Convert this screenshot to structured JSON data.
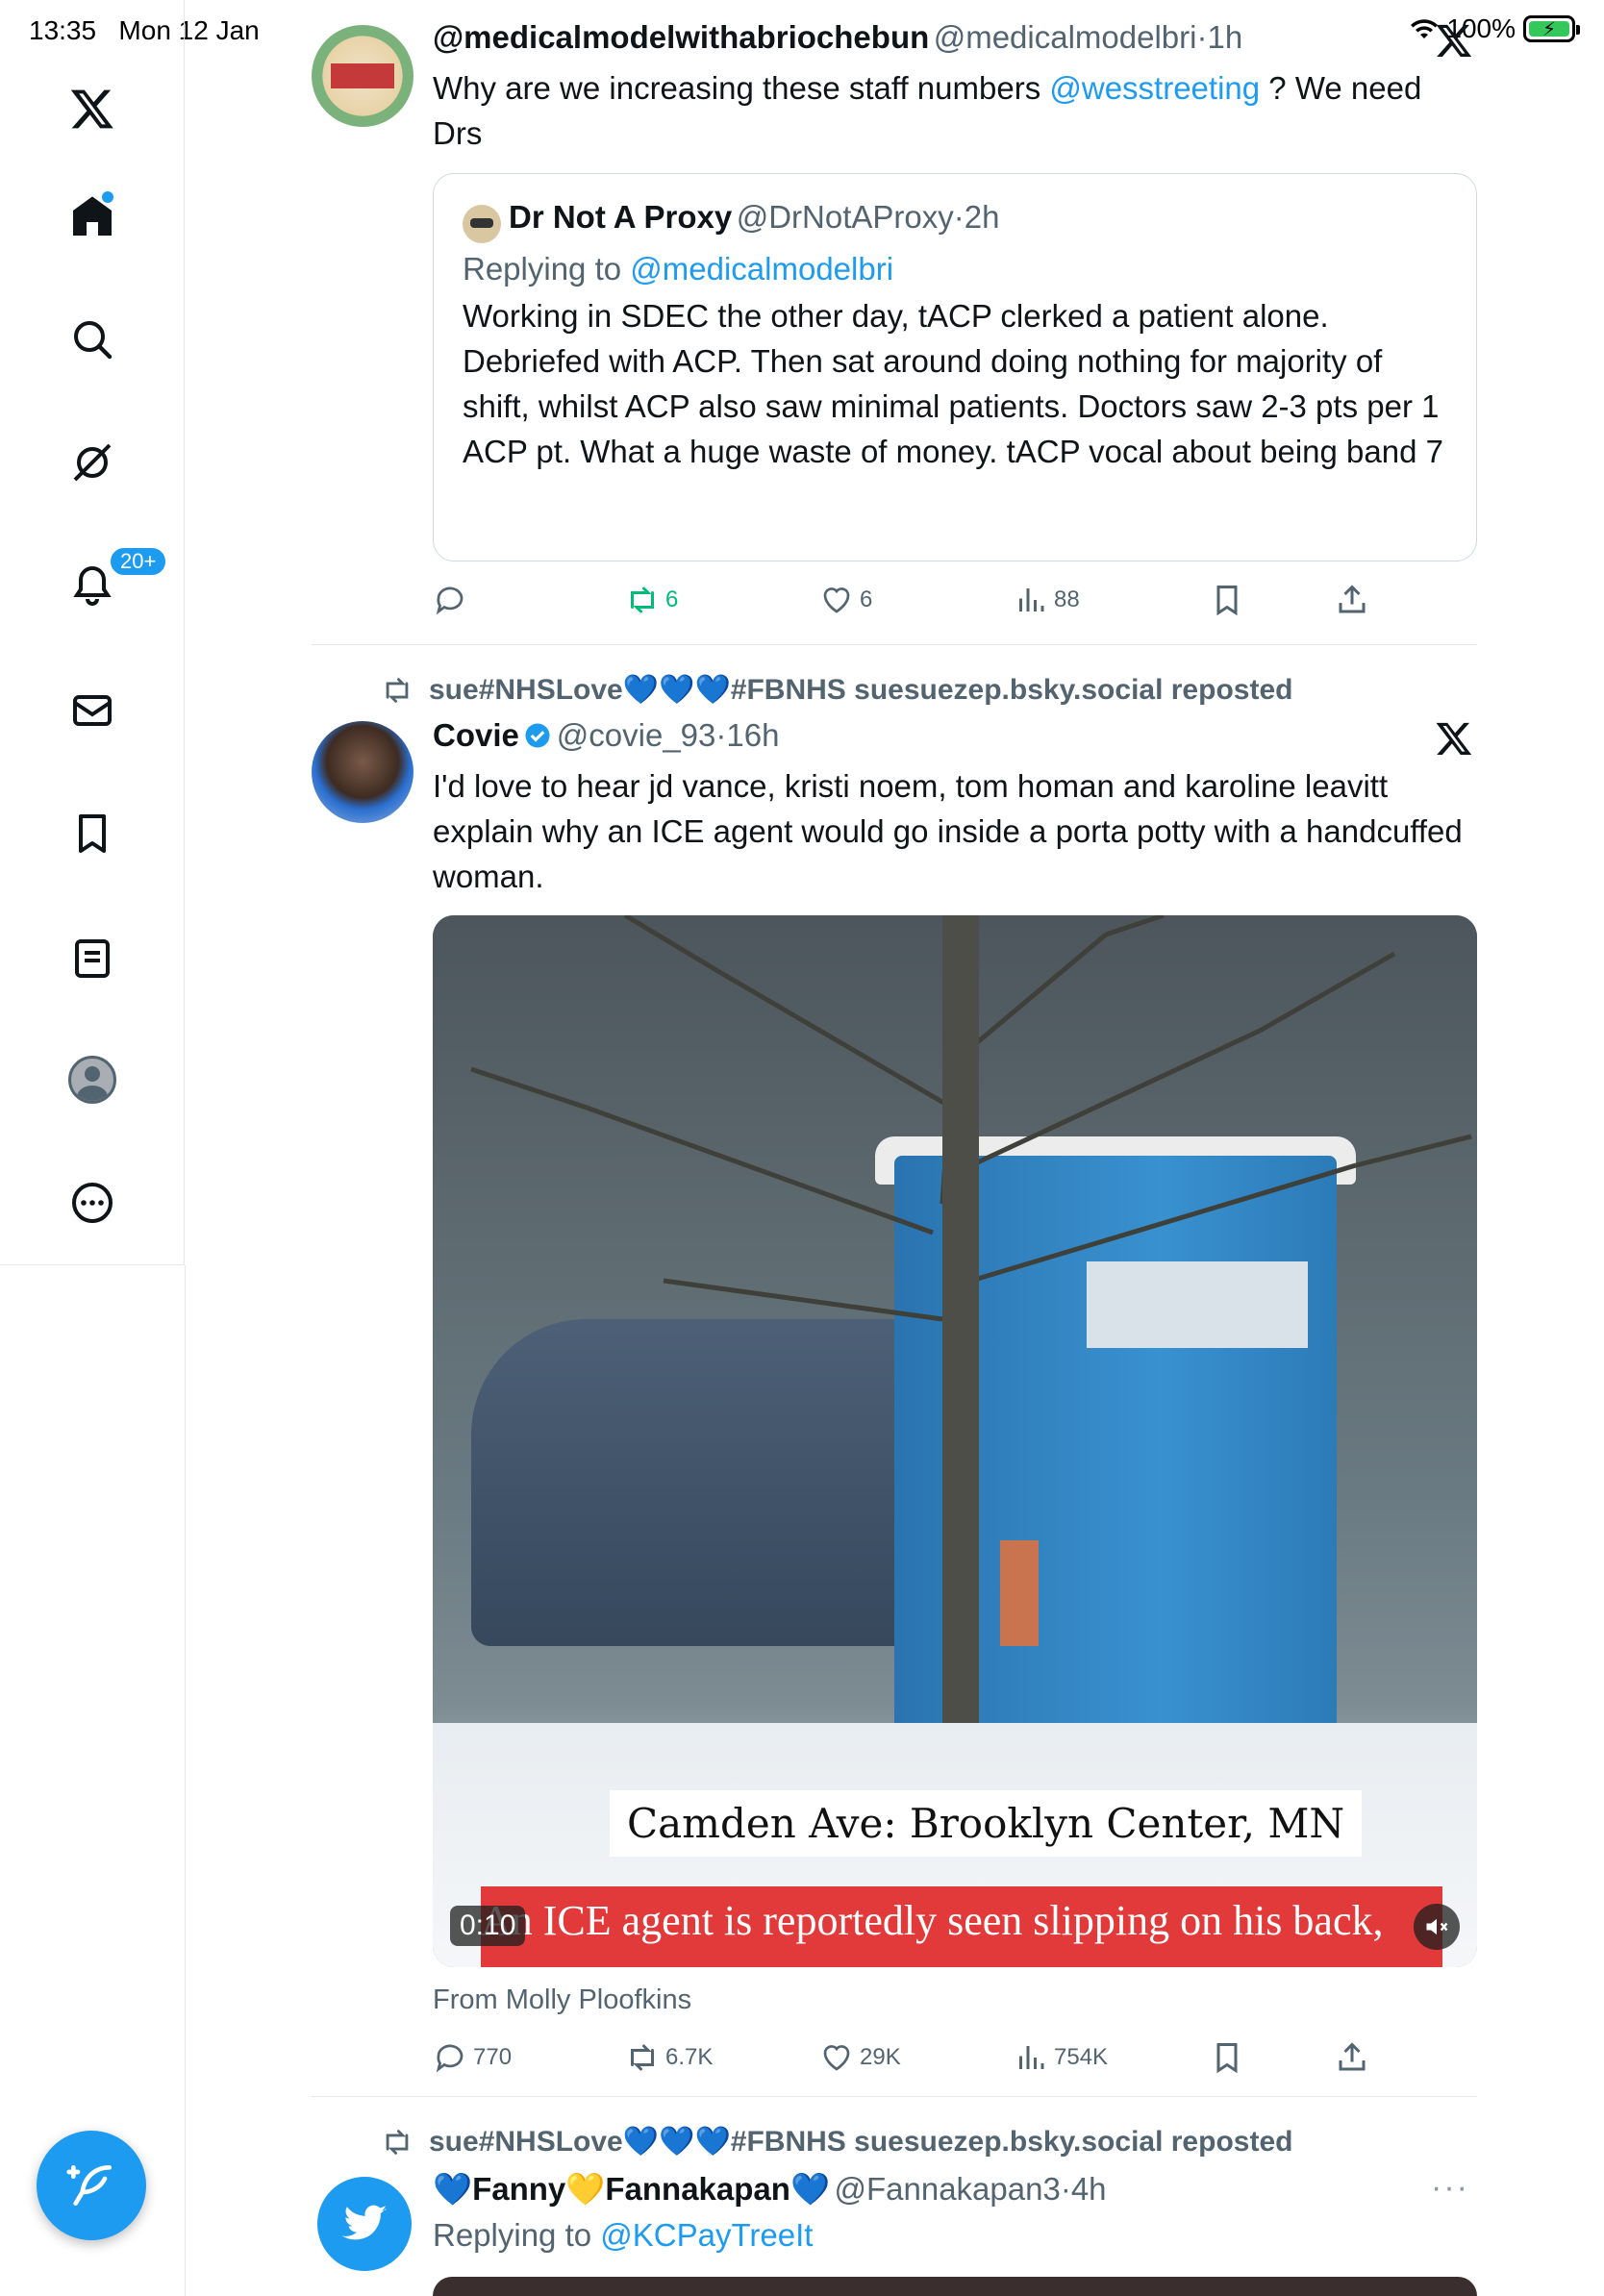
{
  "status_bar": {
    "time": "13:35",
    "date": "Mon 12 Jan",
    "battery": "100%"
  },
  "sidebar": {
    "notifications_badge": "20+",
    "items": [
      "x-logo",
      "home",
      "search",
      "grok",
      "notifications",
      "messages",
      "bookmarks",
      "lists",
      "profile",
      "more"
    ]
  },
  "tweet1": {
    "display_name": "@medicalmodelwithabriochebun",
    "handle": "@medicalmodelbri",
    "time": "1h",
    "text_pre": "Why are we increasing these staff numbers ",
    "mention": "@wesstreeting",
    "text_post": " ? We need Drs",
    "quote": {
      "display_name": "Dr Not A Proxy",
      "handle": "@DrNotAProxy",
      "time": "2h",
      "replying_label": "Replying to ",
      "replying_handle": "@medicalmodelbri",
      "text": "Working in SDEC the other day, tACP clerked a patient alone. Debriefed with ACP. Then sat around doing nothing for majority of shift, whilst ACP also saw minimal patients. Doctors saw 2-3 pts per 1 ACP pt. What a huge waste of money. tACP vocal about being band 7"
    },
    "actions": {
      "reposts": "6",
      "likes": "6",
      "views": "88"
    }
  },
  "tweet2": {
    "repost_by": "sue#NHSLove💙💙💙#FBNHS suesuezep.bsky.social reposted",
    "display_name": "Covie",
    "handle": "@covie_93",
    "time": "16h",
    "text": "I'd love to hear jd vance, kristi noem, tom homan and karoline leavitt explain why an ICE agent would go inside a porta potty with a handcuffed woman.",
    "media": {
      "caption_location": "Camden Ave: Brooklyn Center, MN",
      "caption_news": "An ICE agent is reportedly seen slipping on his back,",
      "duration": "0:10"
    },
    "from": "From Molly Ploofkins",
    "actions": {
      "replies": "770",
      "reposts": "6.7K",
      "likes": "29K",
      "views": "754K"
    }
  },
  "tweet3": {
    "repost_by": "sue#NHSLove💙💙💙#FBNHS suesuezep.bsky.social reposted",
    "name_part1": "Fanny",
    "name_part2": "Fannakapan",
    "handle": "@Fannakapan3",
    "time": "4h",
    "replying_label": "Replying to ",
    "replying_handle": "@KCPayTreeIt",
    "more": "···"
  },
  "colors": {
    "accent": "#1d9bf0",
    "text": "#0f1419",
    "secondary": "#536471",
    "repost_green": "#00ba7c"
  }
}
